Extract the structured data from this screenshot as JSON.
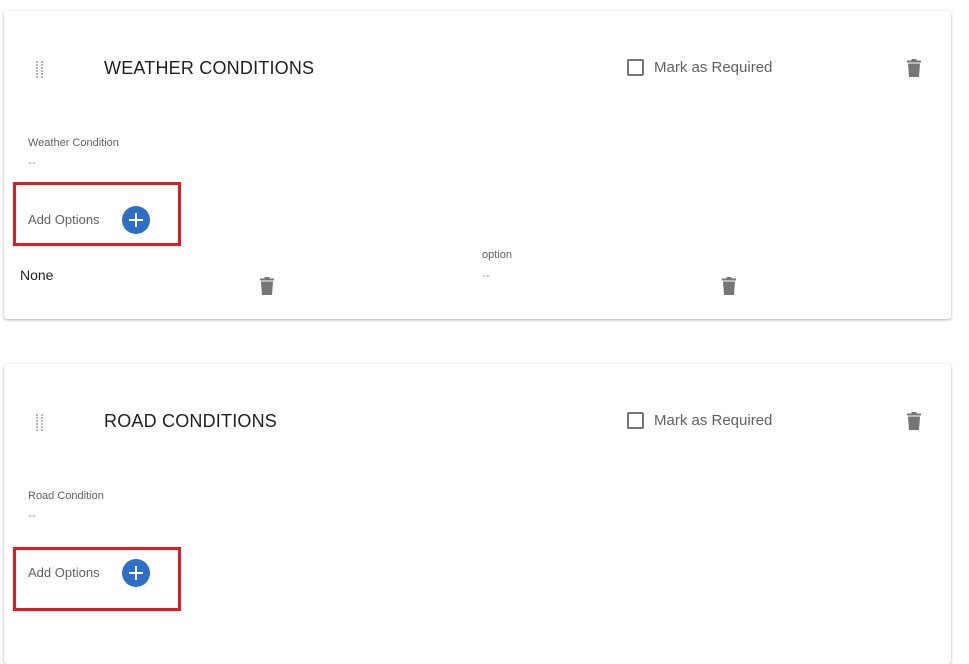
{
  "sections": [
    {
      "title": "WEATHER CONDITIONS",
      "required_label": "Mark as Required",
      "field_label": "Weather Condition",
      "field_value": "--",
      "add_options_label": "Add Options",
      "option": {
        "name": "None",
        "label": "option",
        "value": "--"
      }
    },
    {
      "title": "ROAD CONDITIONS",
      "required_label": "Mark as Required",
      "field_label": "Road Condition",
      "field_value": "--",
      "add_options_label": "Add Options"
    }
  ],
  "colors": {
    "accent": "#2d6fc7",
    "highlight": "#e01b24",
    "icon": "#757575"
  },
  "icons": [
    "drag-handle-icon",
    "checkbox-icon",
    "trash-icon",
    "plus-circle-icon"
  ]
}
